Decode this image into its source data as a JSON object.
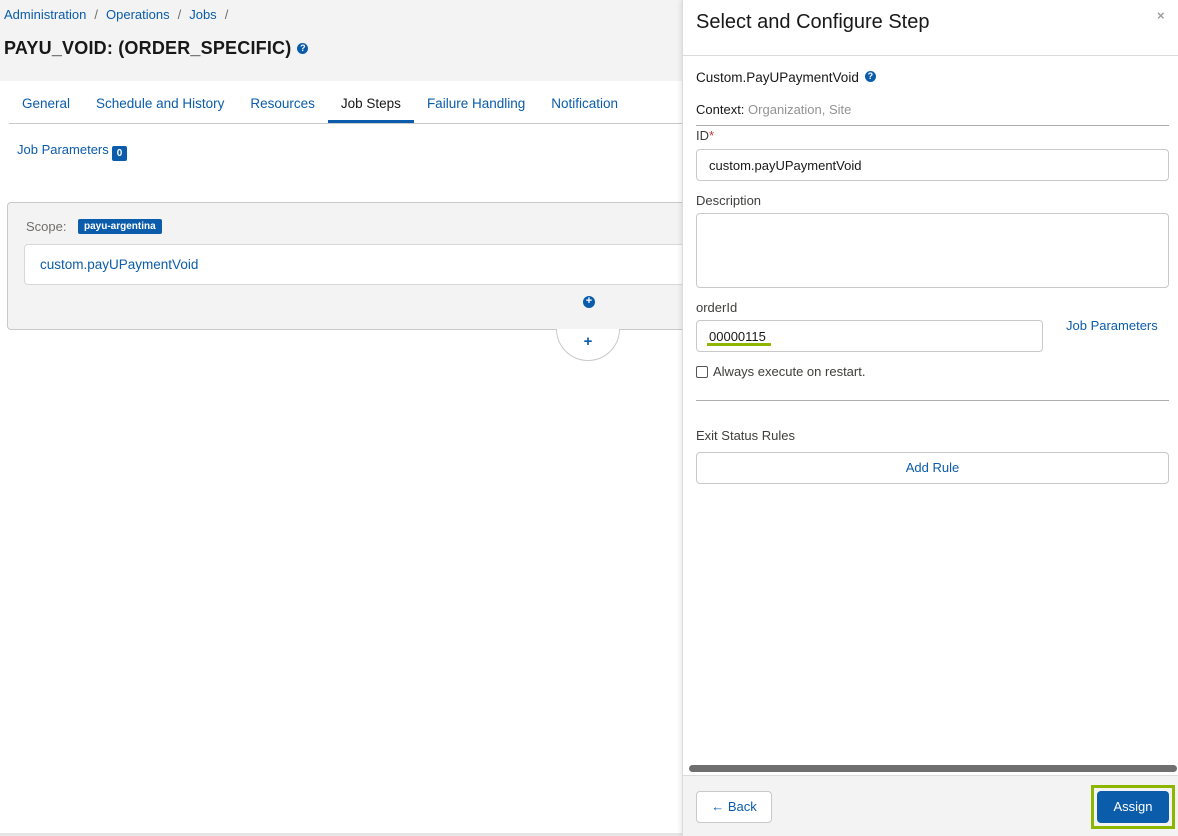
{
  "breadcrumb": [
    "Administration",
    "Operations",
    "Jobs"
  ],
  "breadcrumb_sep": "/",
  "page_title": "PAYU_VOID: (ORDER_SPECIFIC)",
  "tabs": [
    {
      "label": "General",
      "active": false
    },
    {
      "label": "Schedule and History",
      "active": false
    },
    {
      "label": "Resources",
      "active": false
    },
    {
      "label": "Job Steps",
      "active": true
    },
    {
      "label": "Failure Handling",
      "active": false
    },
    {
      "label": "Notification",
      "active": false
    }
  ],
  "job_parameters": {
    "label": "Job Parameters",
    "count": "0"
  },
  "scope": {
    "label": "Scope:",
    "value": "payu-argentina"
  },
  "step_item": "custom.payUPaymentVoid",
  "add_icon": "+",
  "panel": {
    "title": "Select and Configure Step",
    "close": "×",
    "step_name": "Custom.PayUPaymentVoid",
    "help": "?",
    "context_label": "Context:",
    "context_value": "Organization, Site",
    "id_label": "ID",
    "required_mark": "*",
    "id_value": "custom.payUPaymentVoid",
    "description_label": "Description",
    "description_value": "",
    "order_label": "orderId",
    "order_value": "00000115",
    "job_params_link": "Job Parameters",
    "checkbox_label": "Always execute on restart.",
    "checkbox_checked": false,
    "exit_status_label": "Exit Status Rules",
    "add_rule": "Add Rule",
    "back_label": "Back",
    "back_icon": "←",
    "assign_label": "Assign"
  },
  "colors": {
    "accent": "#0b5cab",
    "highlight": "#8db600"
  }
}
